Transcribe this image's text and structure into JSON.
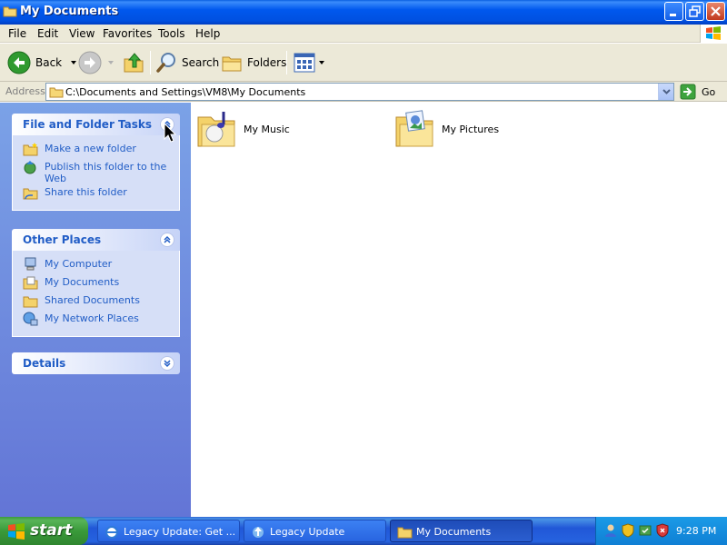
{
  "window": {
    "title": "My Documents",
    "icon": "folder-icon"
  },
  "menu": [
    "File",
    "Edit",
    "View",
    "Favorites",
    "Tools",
    "Help"
  ],
  "toolbar": {
    "back_label": "Back",
    "search_label": "Search",
    "folders_label": "Folders"
  },
  "address": {
    "label": "Address",
    "path": "C:\\Documents and Settings\\VM8\\My Documents",
    "go_label": "Go"
  },
  "tasks": {
    "file_folder": {
      "title": "File and Folder Tasks",
      "items": [
        "Make a new folder",
        "Publish this folder to the Web",
        "Share this folder"
      ]
    },
    "other_places": {
      "title": "Other Places",
      "items": [
        "My Computer",
        "My Documents",
        "Shared Documents",
        "My Network Places"
      ]
    },
    "details": {
      "title": "Details"
    }
  },
  "files": [
    {
      "name": "My Music",
      "icon": "music-folder-icon"
    },
    {
      "name": "My Pictures",
      "icon": "pictures-folder-icon"
    }
  ],
  "taskbar": {
    "start_label": "start",
    "tasks": [
      "Legacy Update: Get ...",
      "Legacy Update",
      "My Documents"
    ],
    "clock": "9:28 PM"
  },
  "colors": {
    "titlebar": "#0054e3",
    "taskpane": "#6f8fe0",
    "link": "#215dc6",
    "start": "#3a9a3a"
  }
}
